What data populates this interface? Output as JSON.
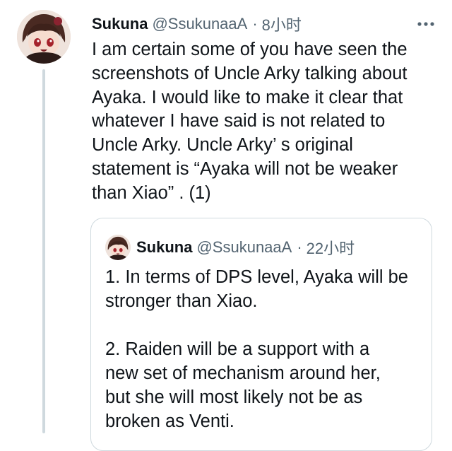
{
  "tweet": {
    "author_name": "Sukuna",
    "author_handle": "@SsukunaaA",
    "separator": "·",
    "time": "8小时",
    "more_icon": "more-horizontal-icon",
    "text_lines": [
      "I am certain some of you have seen the",
      "screenshots of Uncle Arky talking about",
      "Ayaka. I would like to make it clear that",
      "whatever I have said is not related to",
      "Uncle Arky. Uncle Arky’ s original",
      "statement is “Ayaka will not be weaker",
      "than Xiao” . (1)"
    ]
  },
  "quoted_tweet": {
    "author_name": "Sukuna",
    "author_handle": "@SsukunaaA",
    "separator": "·",
    "time": "22小时",
    "text_lines_1": [
      "1. In terms of DPS level, Ayaka will be",
      "stronger than Xiao."
    ],
    "text_lines_2": [
      "2. Raiden will be a support with a",
      "new set of mechanism around her,",
      "but she will most likely not be as",
      "broken as Venti."
    ]
  },
  "colors": {
    "text_primary": "#0f1419",
    "text_secondary": "#536471",
    "border": "#cfd9de",
    "background": "#ffffff"
  }
}
